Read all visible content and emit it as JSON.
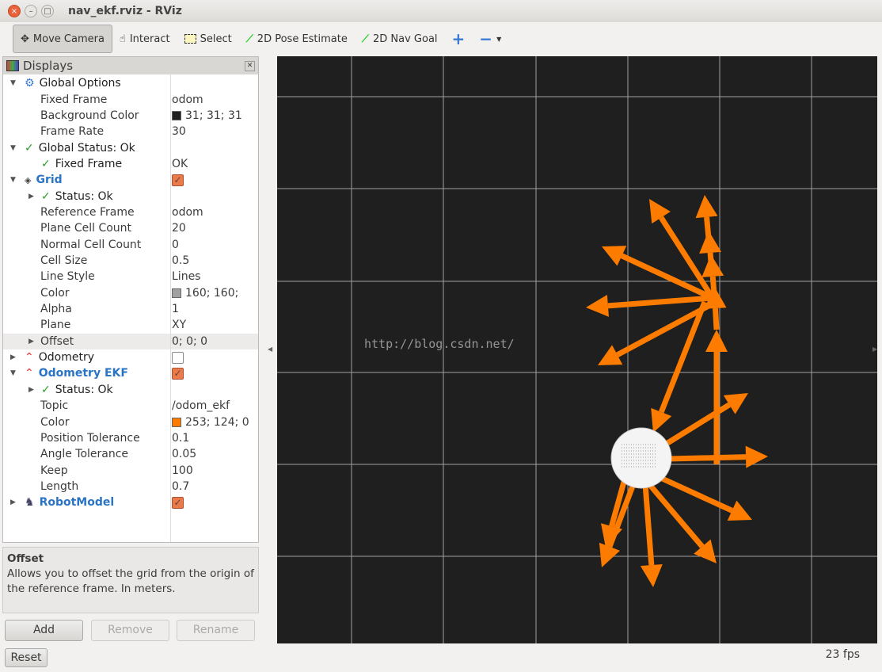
{
  "window": {
    "title": "nav_ekf.rviz - RViz"
  },
  "toolbar": {
    "items": [
      {
        "label": "Move Camera",
        "icon": "move-camera-icon",
        "active": true
      },
      {
        "label": "Interact",
        "icon": "hand-icon"
      },
      {
        "label": "Select",
        "icon": "select-box-icon"
      },
      {
        "label": "2D Pose Estimate",
        "icon": "green-arrow-icon"
      },
      {
        "label": "2D Nav Goal",
        "icon": "green-arrow-icon"
      }
    ]
  },
  "displays": {
    "title": "Displays",
    "rows": [
      {
        "label": "Global Options",
        "value": "",
        "level": 0,
        "icon": "gear-icon",
        "expand": "open"
      },
      {
        "label": "Fixed Frame",
        "value": "odom",
        "level": 1
      },
      {
        "label": "Background Color",
        "value": "31; 31; 31",
        "level": 1,
        "swatch": "#1f1f1f"
      },
      {
        "label": "Frame Rate",
        "value": "30",
        "level": 1
      },
      {
        "label": "Global Status: Ok",
        "value": "",
        "level": 0,
        "icon": "check-icon",
        "expand": "open"
      },
      {
        "label": "Fixed Frame",
        "value": "OK",
        "level": 1,
        "icon": "check-icon"
      },
      {
        "label": "Grid",
        "value": "",
        "level": 0,
        "icon": "grid-icon",
        "expand": "open",
        "blue": true,
        "checkbox": true
      },
      {
        "label": "Status: Ok",
        "value": "",
        "level": 1,
        "icon": "check-icon",
        "expand": "closed"
      },
      {
        "label": "Reference Frame",
        "value": "odom",
        "level": 1
      },
      {
        "label": "Plane Cell Count",
        "value": "20",
        "level": 1
      },
      {
        "label": "Normal Cell Count",
        "value": "0",
        "level": 1
      },
      {
        "label": "Cell Size",
        "value": "0.5",
        "level": 1
      },
      {
        "label": "Line Style",
        "value": "Lines",
        "level": 1
      },
      {
        "label": "Color",
        "value": "160; 160;",
        "level": 1,
        "swatch": "#a0a0a0"
      },
      {
        "label": "Alpha",
        "value": "1",
        "level": 1
      },
      {
        "label": "Plane",
        "value": "XY",
        "level": 1
      },
      {
        "label": "Offset",
        "value": "0; 0; 0",
        "level": 1,
        "expand": "closed",
        "selected": true
      },
      {
        "label": "Odometry",
        "value": "",
        "level": 0,
        "icon": "odometry-icon",
        "expand": "closed",
        "checkbox": false
      },
      {
        "label": "Odometry EKF",
        "value": "",
        "level": 0,
        "icon": "odometry-icon",
        "expand": "open",
        "blue": true,
        "checkbox": true
      },
      {
        "label": "Status: Ok",
        "value": "",
        "level": 1,
        "icon": "check-icon",
        "expand": "closed"
      },
      {
        "label": "Topic",
        "value": "/odom_ekf",
        "level": 1
      },
      {
        "label": "Color",
        "value": "253; 124; 0",
        "level": 1,
        "swatch": "#fd7c00"
      },
      {
        "label": "Position Tolerance",
        "value": "0.1",
        "level": 1
      },
      {
        "label": "Angle Tolerance",
        "value": "0.05",
        "level": 1
      },
      {
        "label": "Keep",
        "value": "100",
        "level": 1
      },
      {
        "label": "Length",
        "value": "0.7",
        "level": 1
      },
      {
        "label": "RobotModel",
        "value": "",
        "level": 0,
        "icon": "robot-icon",
        "expand": "closed",
        "blue": true,
        "checkbox": true
      }
    ]
  },
  "help": {
    "title": "Offset",
    "text": "Allows you to offset the grid from the origin of the reference frame. In meters."
  },
  "buttons": {
    "add": "Add",
    "remove": "Remove",
    "rename": "Rename",
    "reset": "Reset"
  },
  "status": {
    "fps": "23 fps"
  },
  "viewport": {
    "background": "#1f1f1f",
    "grid_color": "#a0a0a0",
    "arrow_color": "#fd7c00",
    "watermark": "http://blog.csdn.net/"
  }
}
